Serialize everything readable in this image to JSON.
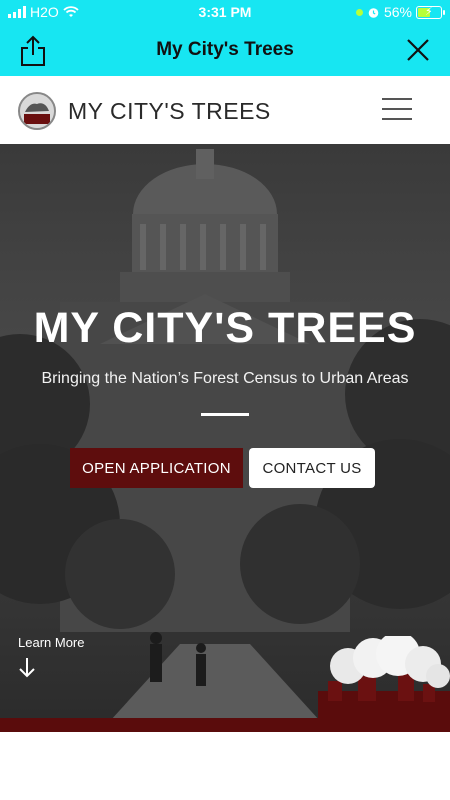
{
  "status_bar": {
    "carrier": "H2O",
    "time": "3:31 PM",
    "battery_percent": "56%",
    "battery_level": 0.56
  },
  "browser_bar": {
    "title": "My City's Trees",
    "icons": [
      "share-icon",
      "close-icon"
    ]
  },
  "site_header": {
    "brand": "MY CITY'S TREES",
    "icons": [
      "logo-icon",
      "hamburger-menu-icon"
    ]
  },
  "hero": {
    "title": "MY CITY'S TREES",
    "subtitle": "Bringing the Nation’s Forest Census to Urban Areas",
    "primary_button": "OPEN APPLICATION",
    "secondary_button": "CONTACT US",
    "learn_more": "Learn More"
  },
  "colors": {
    "browser_bar_bg": "#17e6f2",
    "primary_button_bg": "#5e0d0d",
    "hero_bottom_band": "#5a0c0c"
  }
}
